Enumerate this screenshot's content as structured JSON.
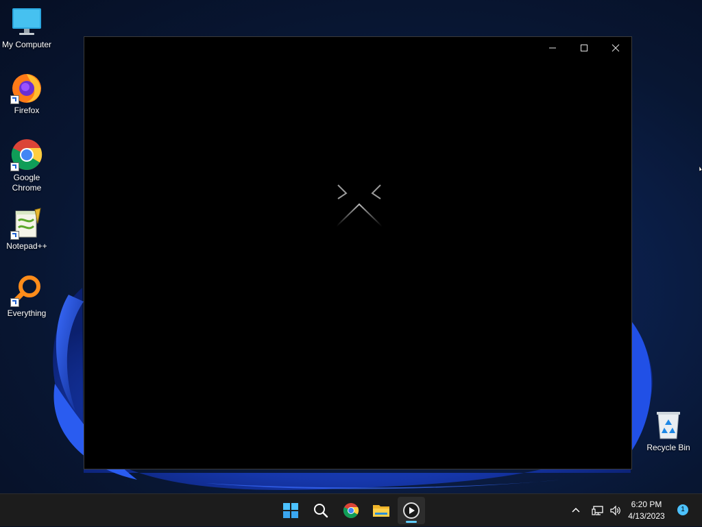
{
  "desktop": {
    "icons": [
      {
        "label": "My Computer",
        "icon": "monitor-icon"
      },
      {
        "label": "Firefox",
        "icon": "firefox-icon"
      },
      {
        "label": "Google Chrome",
        "icon": "chrome-icon"
      },
      {
        "label": "Notepad++",
        "icon": "notepadpp-icon"
      },
      {
        "label": "Everything",
        "icon": "everything-search-icon"
      },
      {
        "label": "Recycle Bin",
        "icon": "recycle-bin-icon"
      }
    ]
  },
  "window": {
    "controls": {
      "minimize": "minimize-icon",
      "maximize": "maximize-icon",
      "close": "close-icon"
    },
    "splash_logo": "xbox-style-x-logo"
  },
  "taskbar": {
    "apps": [
      {
        "name": "Start",
        "icon": "windows-start-icon"
      },
      {
        "name": "Search",
        "icon": "search-icon"
      },
      {
        "name": "Google Chrome",
        "icon": "chrome-icon"
      },
      {
        "name": "File Explorer",
        "icon": "folder-icon"
      },
      {
        "name": "Media Player",
        "icon": "media-player-icon",
        "active": true
      }
    ],
    "tray": {
      "overflow_icon": "chevron-up-icon",
      "network_icon": "network-icon",
      "volume_icon": "volume-icon",
      "time": "6:20 PM",
      "date": "4/13/2023",
      "notification_count": "1"
    }
  },
  "colors": {
    "accent": "#60cdff",
    "taskbar": "#1c1c1c",
    "window_bg": "#000000"
  }
}
